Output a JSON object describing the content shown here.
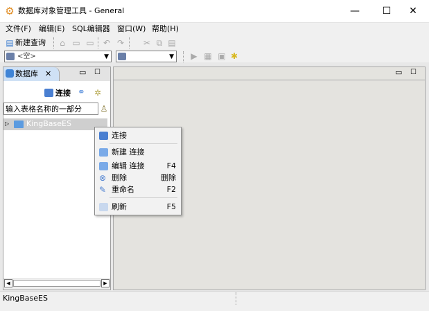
{
  "window": {
    "title": "数据库对象管理工具 - General",
    "min_glyph": "—",
    "max_glyph": "☐",
    "close_glyph": "✕"
  },
  "menubar": {
    "items": [
      "文件(F)",
      "编辑(E)",
      "SQL编辑器",
      "窗口(W)",
      "帮助(H)"
    ]
  },
  "toolbar": {
    "new_query_label": "新建查询",
    "combo1_value": "<空>",
    "combo2_value": ""
  },
  "left_view": {
    "tab_label": "数据库",
    "tab_close_glyph": "✕",
    "min_glyph": "▭",
    "max_glyph": "☐",
    "connect_label": "连接",
    "filter_placeholder": "输入表格名称的一部分",
    "tree_items": [
      "KingBaseES"
    ]
  },
  "right_view": {
    "min_glyph": "▭",
    "max_glyph": "☐"
  },
  "context_menu": {
    "items": [
      {
        "label": "连接",
        "shortcut": ""
      },
      {
        "label": "新建 连接",
        "shortcut": ""
      },
      {
        "label": "编辑 连接",
        "shortcut": "F4"
      },
      {
        "label": "删除",
        "shortcut": "删除"
      },
      {
        "label": "重命名",
        "shortcut": "F2"
      },
      {
        "label": "刷新",
        "shortcut": "F5"
      }
    ]
  },
  "statusbar": {
    "text": "KingBaseES"
  },
  "colors": {
    "accent": "#3f84d6",
    "selection": "#cfcfcf",
    "menu_bg": "#f2f2f2"
  }
}
